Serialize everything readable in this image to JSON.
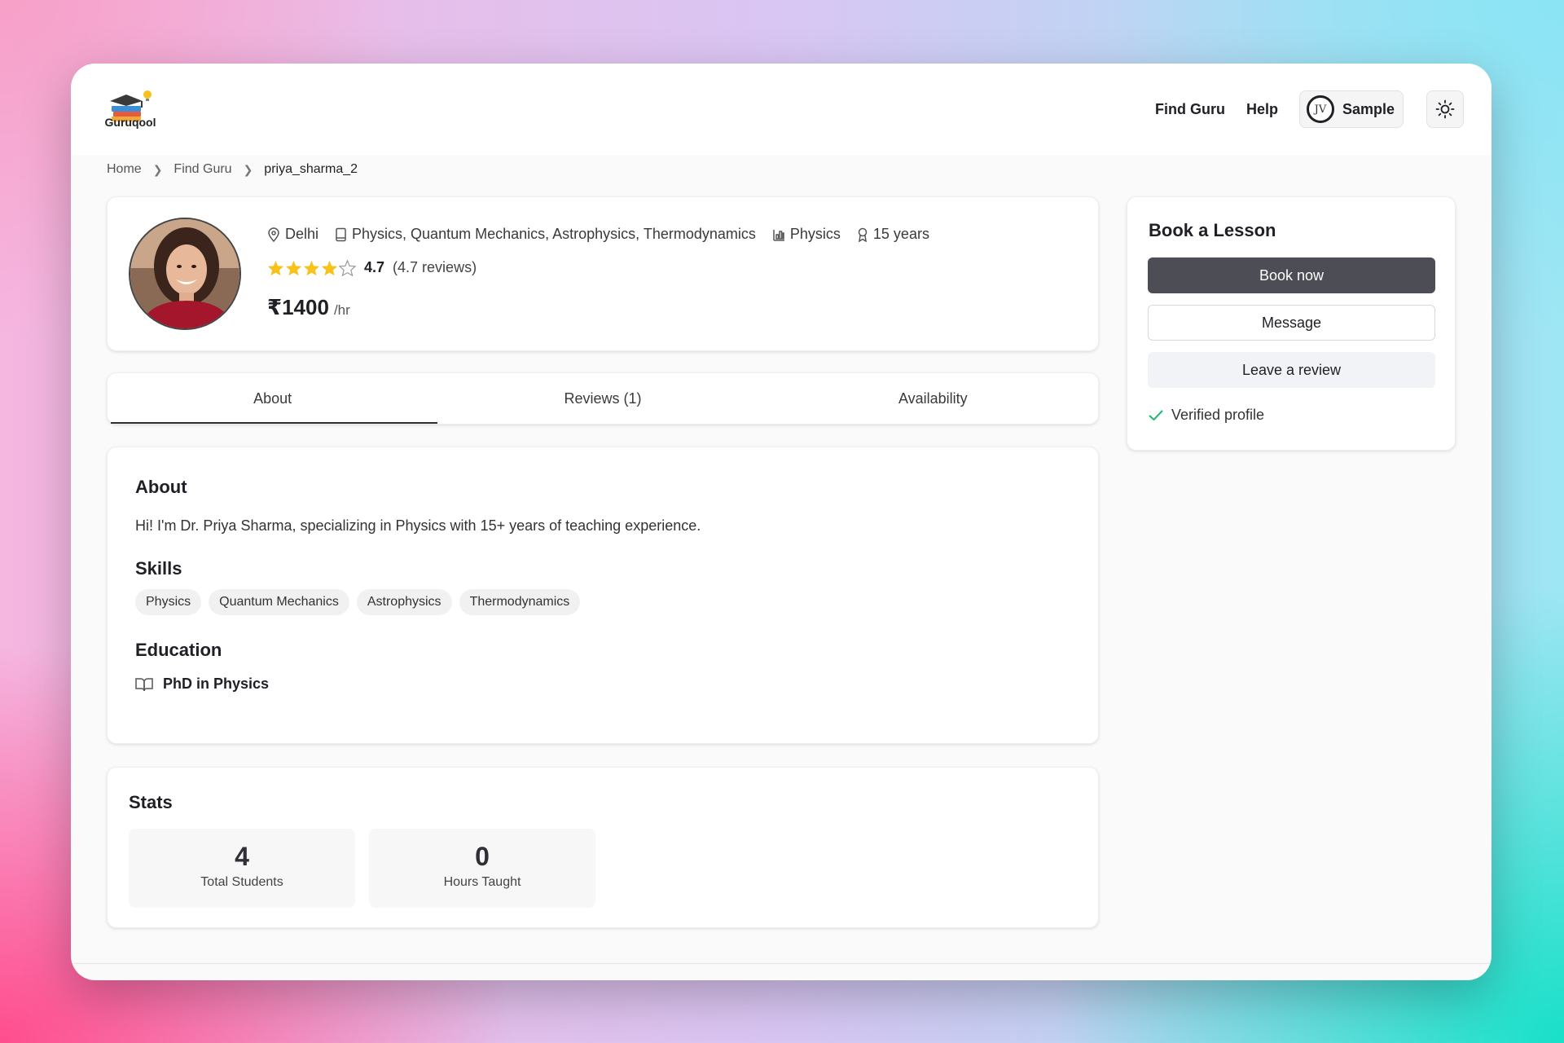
{
  "brand": {
    "name": "Guruqool"
  },
  "nav": {
    "links": [
      "Find Guru",
      "Help"
    ],
    "user": {
      "initials": "JV",
      "name": "Sample"
    },
    "theme_icon": "sun-icon"
  },
  "breadcrumb": [
    "Home",
    "Find Guru",
    "priya_sharma_2"
  ],
  "profile": {
    "location": "Delhi",
    "subjects": "Physics, Quantum Mechanics, Astrophysics, Thermodynamics",
    "category": "Physics",
    "experience": "15 years",
    "rating": "4.7",
    "rating_stars": 4,
    "reviews_text": "(4.7 reviews)",
    "price": "₹1400",
    "price_unit": "/hr"
  },
  "tabs": [
    "About",
    "Reviews (1)",
    "Availability"
  ],
  "about": {
    "title": "About",
    "text": "Hi! I'm Dr. Priya Sharma, specializing in Physics with 15+ years of teaching experience.",
    "skills_title": "Skills",
    "skills": [
      "Physics",
      "Quantum Mechanics",
      "Astrophysics",
      "Thermodynamics"
    ],
    "education_title": "Education",
    "education": "PhD in Physics"
  },
  "stats": {
    "title": "Stats",
    "items": [
      {
        "value": "4",
        "label": "Total Students"
      },
      {
        "value": "0",
        "label": "Hours Taught"
      }
    ]
  },
  "booking": {
    "title": "Book a Lesson",
    "book_label": "Book now",
    "message_label": "Message",
    "review_label": "Leave a review",
    "verified_label": "Verified profile"
  },
  "colors": {
    "primary_button": "#4c4d55",
    "star": "#f7c21a",
    "verified": "#22b573"
  }
}
